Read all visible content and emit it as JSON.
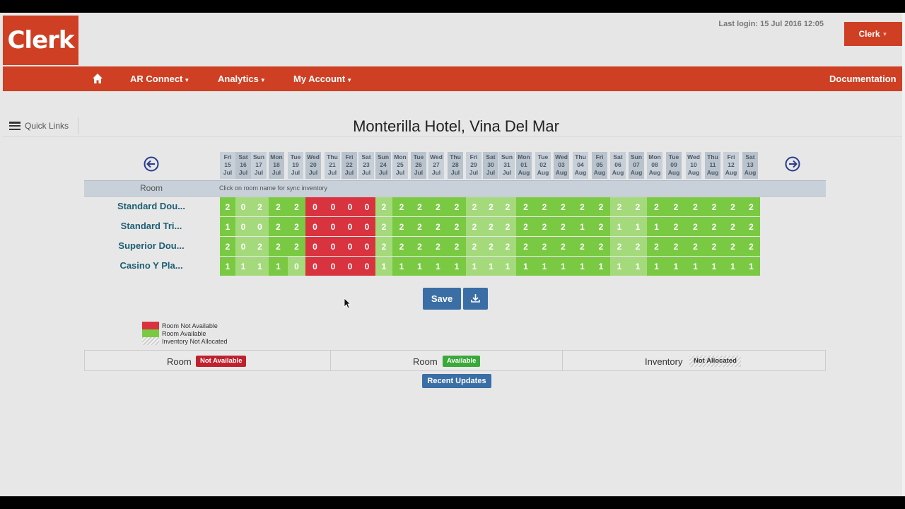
{
  "header": {
    "logo": "Clerk",
    "last_login": "Last login: 15 Jul 2016 12:05",
    "user_label": "Clerk"
  },
  "nav": {
    "items": [
      {
        "label": "AR Connect"
      },
      {
        "label": "Analytics"
      },
      {
        "label": "My Account"
      }
    ],
    "documentation": "Documentation"
  },
  "quick_links": "Quick Links",
  "page_title": "Monterilla Hotel, Vina Del Mar",
  "grid": {
    "room_header": "Room",
    "hint": "Click on room name for sync inventory",
    "dates": [
      {
        "day": "Fri",
        "num": "15",
        "mon": "Jul"
      },
      {
        "day": "Sat",
        "num": "16",
        "mon": "Jul"
      },
      {
        "day": "Sun",
        "num": "17",
        "mon": "Jul"
      },
      {
        "day": "Mon",
        "num": "18",
        "mon": "Jul"
      },
      {
        "day": "Tue",
        "num": "19",
        "mon": "Jul"
      },
      {
        "day": "Wed",
        "num": "20",
        "mon": "Jul"
      },
      {
        "day": "Thu",
        "num": "21",
        "mon": "Jul"
      },
      {
        "day": "Fri",
        "num": "22",
        "mon": "Jul"
      },
      {
        "day": "Sat",
        "num": "23",
        "mon": "Jul"
      },
      {
        "day": "Sun",
        "num": "24",
        "mon": "Jul"
      },
      {
        "day": "Mon",
        "num": "25",
        "mon": "Jul"
      },
      {
        "day": "Tue",
        "num": "26",
        "mon": "Jul"
      },
      {
        "day": "Wed",
        "num": "27",
        "mon": "Jul"
      },
      {
        "day": "Thu",
        "num": "28",
        "mon": "Jul"
      },
      {
        "day": "Fri",
        "num": "29",
        "mon": "Jul"
      },
      {
        "day": "Sat",
        "num": "30",
        "mon": "Jul"
      },
      {
        "day": "Sun",
        "num": "31",
        "mon": "Jul"
      },
      {
        "day": "Mon",
        "num": "01",
        "mon": "Aug"
      },
      {
        "day": "Tue",
        "num": "02",
        "mon": "Aug"
      },
      {
        "day": "Wed",
        "num": "03",
        "mon": "Aug"
      },
      {
        "day": "Thu",
        "num": "04",
        "mon": "Aug"
      },
      {
        "day": "Fri",
        "num": "05",
        "mon": "Aug"
      },
      {
        "day": "Sat",
        "num": "06",
        "mon": "Aug"
      },
      {
        "day": "Sun",
        "num": "07",
        "mon": "Aug"
      },
      {
        "day": "Mon",
        "num": "08",
        "mon": "Aug"
      },
      {
        "day": "Tue",
        "num": "09",
        "mon": "Aug"
      },
      {
        "day": "Wed",
        "num": "10",
        "mon": "Aug"
      },
      {
        "day": "Thu",
        "num": "11",
        "mon": "Aug"
      },
      {
        "day": "Fri",
        "num": "12",
        "mon": "Aug"
      },
      {
        "day": "Sat",
        "num": "13",
        "mon": "Aug"
      }
    ],
    "rooms": [
      {
        "name": "Standard Dou...",
        "values": [
          "2",
          "0",
          "2",
          "2",
          "2",
          "0",
          "0",
          "0",
          "0",
          "2",
          "2",
          "2",
          "2",
          "2",
          "2",
          "2",
          "2",
          "2",
          "2",
          "2",
          "2",
          "2",
          "2",
          "2",
          "2",
          "2",
          "2",
          "2",
          "2",
          "2"
        ]
      },
      {
        "name": "Standard Tri...",
        "values": [
          "1",
          "0",
          "0",
          "2",
          "2",
          "0",
          "0",
          "0",
          "0",
          "2",
          "2",
          "2",
          "2",
          "2",
          "2",
          "2",
          "2",
          "2",
          "2",
          "2",
          "1",
          "2",
          "1",
          "1",
          "1",
          "2",
          "2",
          "2",
          "2",
          "2"
        ]
      },
      {
        "name": "Superior Dou...",
        "values": [
          "2",
          "0",
          "2",
          "2",
          "2",
          "0",
          "0",
          "0",
          "0",
          "2",
          "2",
          "2",
          "2",
          "2",
          "2",
          "2",
          "2",
          "2",
          "2",
          "2",
          "2",
          "2",
          "2",
          "2",
          "2",
          "2",
          "2",
          "2",
          "2",
          "2"
        ]
      },
      {
        "name": "Casino Y Pla...",
        "values": [
          "1",
          "1",
          "1",
          "1",
          "0",
          "0",
          "0",
          "0",
          "0",
          "1",
          "1",
          "1",
          "1",
          "1",
          "1",
          "1",
          "1",
          "1",
          "1",
          "1",
          "1",
          "1",
          "1",
          "1",
          "1",
          "1",
          "1",
          "1",
          "1",
          "1"
        ]
      }
    ]
  },
  "actions": {
    "save": "Save"
  },
  "legend": {
    "not_available": "Room Not Available",
    "available": "Room Available",
    "not_allocated": "Inventory Not Allocated"
  },
  "status": {
    "room1_label": "Room",
    "room1_badge": "Not Available",
    "room2_label": "Room",
    "room2_badge": "Available",
    "inv_label": "Inventory",
    "inv_badge": "Not Allocated"
  },
  "recent_updates": "Recent Updates",
  "colors": {
    "brand": "#cf3f23",
    "unavailable": "#d9333f",
    "available": "#7ac943",
    "button": "#3a6ea5"
  }
}
